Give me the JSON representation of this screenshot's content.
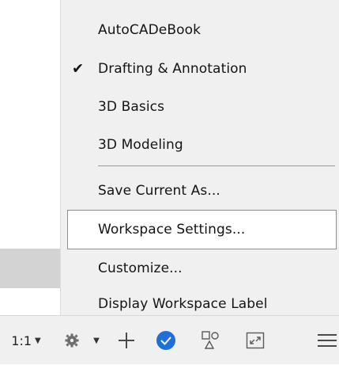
{
  "menu": {
    "items": [
      {
        "label": "AutoCADeBook",
        "checked": false
      },
      {
        "label": "Drafting & Annotation",
        "checked": true
      },
      {
        "label": "3D Basics",
        "checked": false
      },
      {
        "label": "3D Modeling",
        "checked": false
      },
      {
        "label": "Save Current As...",
        "checked": false
      },
      {
        "label": "Workspace Settings...",
        "checked": false,
        "hovered": true
      },
      {
        "label": "Customize...",
        "checked": false
      },
      {
        "label": "Display Workspace Label",
        "checked": false
      }
    ],
    "check_glyph": "✔"
  },
  "statusbar": {
    "scale_label": "1:1",
    "caret_glyph": "▼",
    "icons": [
      "scale-dropdown-icon",
      "gear-icon",
      "plus-icon",
      "blue-circle-icon",
      "shapes-icon",
      "expand-icon",
      "hamburger-menu-icon"
    ]
  },
  "colors": {
    "menu_bg": "#f0f0f0",
    "hover_bg": "#ffffff",
    "hover_border": "#8e8e8e",
    "accent_blue": "#1e6fd9"
  }
}
